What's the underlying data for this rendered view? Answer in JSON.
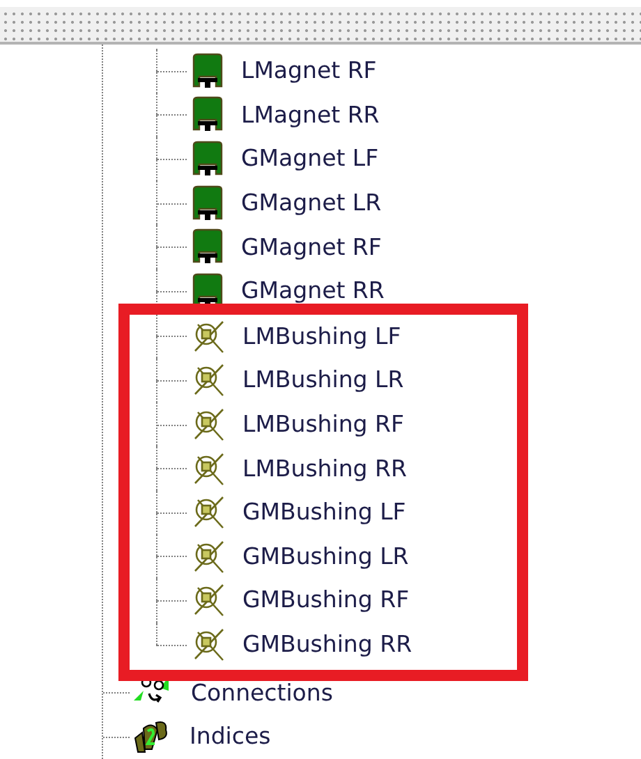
{
  "tree": {
    "items": [
      {
        "kind": "group",
        "sections": [
          {
            "framed": false,
            "children": [
              {
                "kind": "magnet",
                "label": "LMagnet RF"
              },
              {
                "kind": "magnet",
                "label": "LMagnet RR"
              },
              {
                "kind": "magnet",
                "label": "GMagnet LF"
              },
              {
                "kind": "magnet",
                "label": "GMagnet LR"
              },
              {
                "kind": "magnet",
                "label": "GMagnet RF"
              },
              {
                "kind": "magnet",
                "label": "GMagnet RR"
              }
            ]
          },
          {
            "framed": true,
            "children": [
              {
                "kind": "bushing",
                "label": "LMBushing LF"
              },
              {
                "kind": "bushing",
                "label": "LMBushing LR"
              },
              {
                "kind": "bushing",
                "label": "LMBushing RF"
              },
              {
                "kind": "bushing",
                "label": "LMBushing RR"
              },
              {
                "kind": "bushing",
                "label": "GMBushing LF"
              },
              {
                "kind": "bushing",
                "label": "GMBushing LR"
              },
              {
                "kind": "bushing",
                "label": "GMBushing RF"
              },
              {
                "kind": "bushing",
                "label": "GMBushing RR"
              }
            ]
          }
        ]
      },
      {
        "kind": "connections",
        "label": "Connections"
      },
      {
        "kind": "indices",
        "label": "Indices"
      }
    ]
  }
}
